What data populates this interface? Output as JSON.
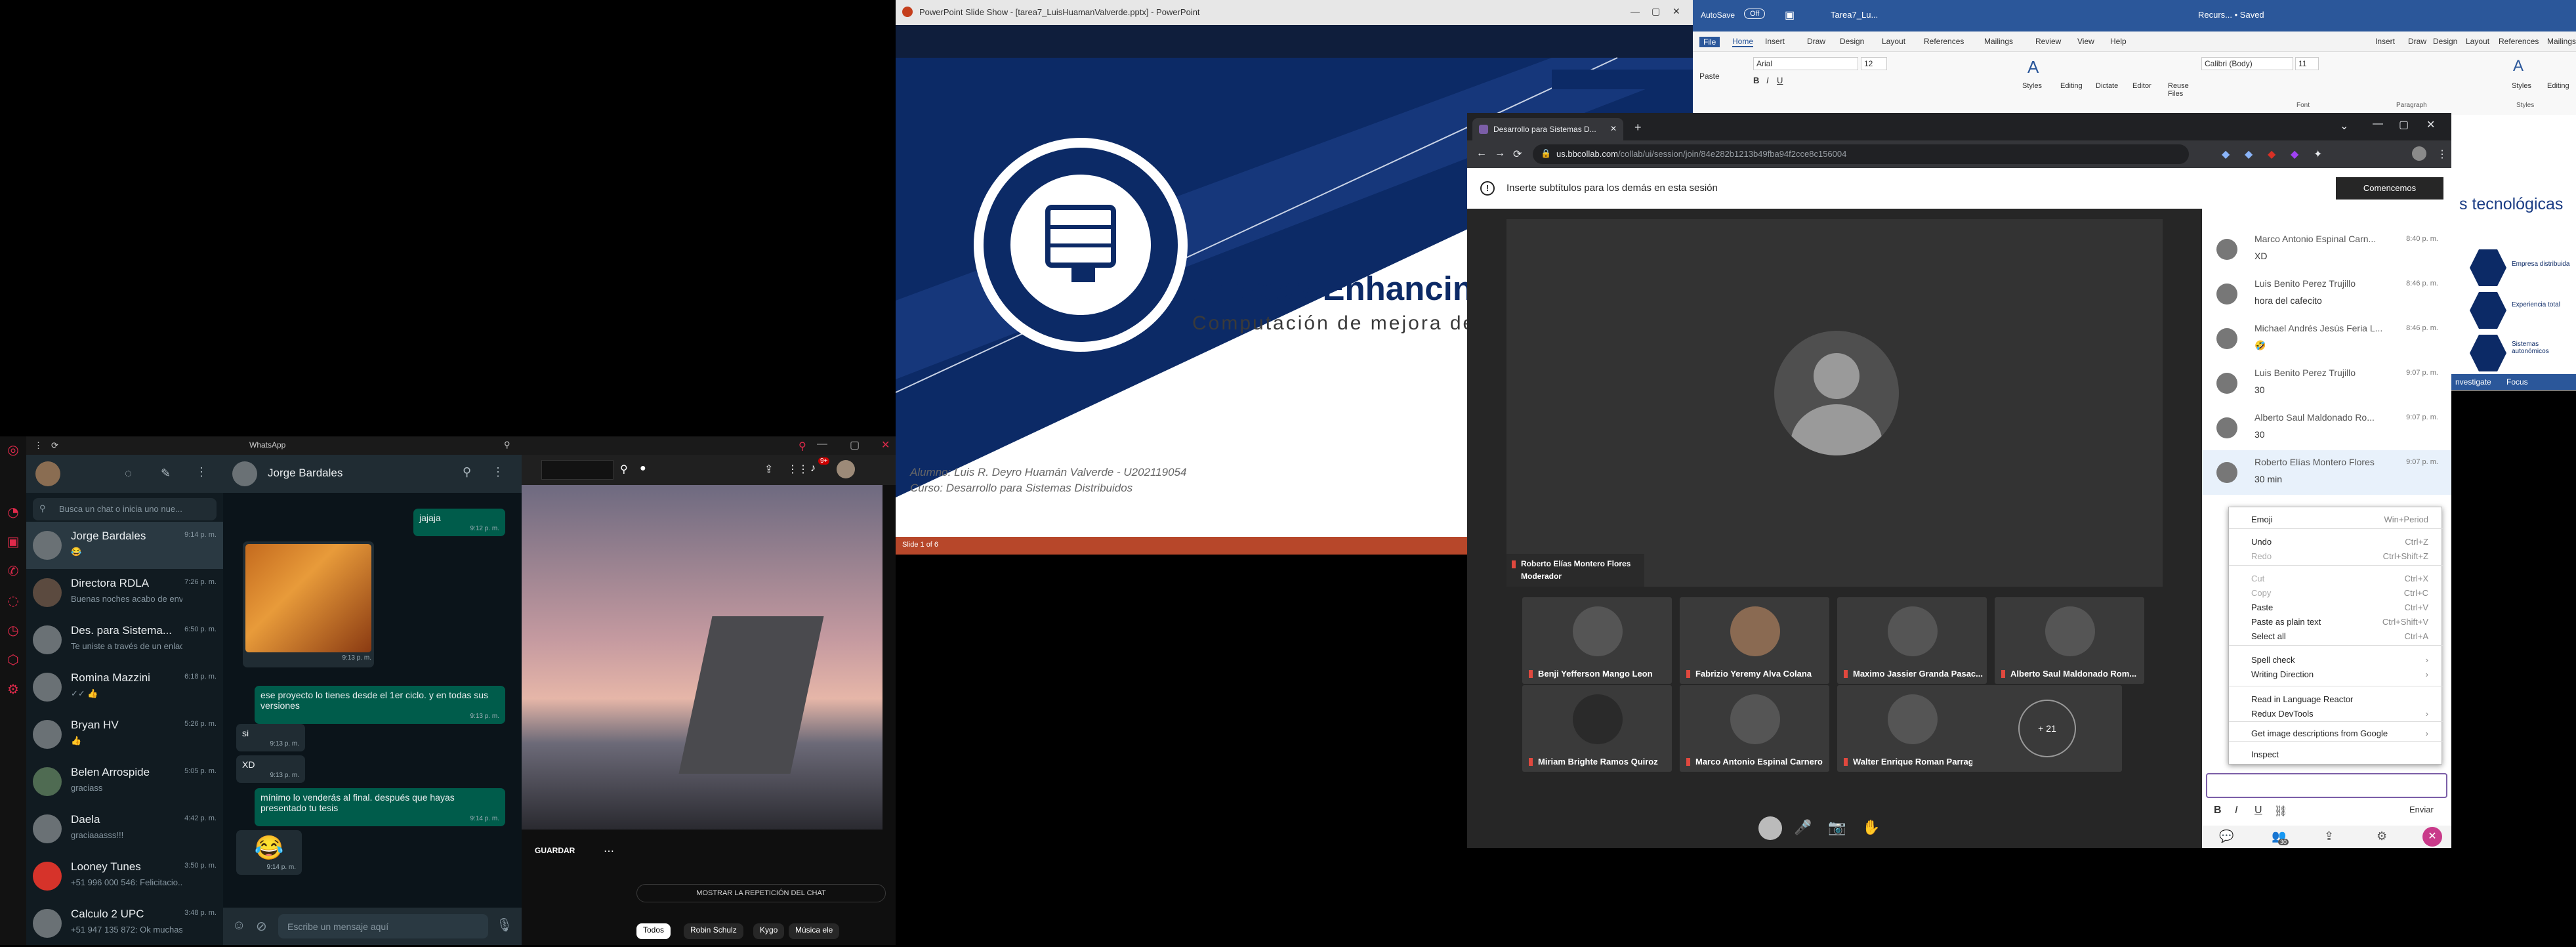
{
  "whatsapp": {
    "window_title": "WhatsApp",
    "search_placeholder": "Busca un chat o inicia uno nue...",
    "contact_name": "Jorge Bardales",
    "compose_placeholder": "Escribe un mensaje aquí",
    "chats": [
      {
        "name": "Jorge Bardales",
        "preview": "😂",
        "time": "9:14 p. m."
      },
      {
        "name": "Directora RDLA",
        "preview": "Buenas noches acabo de envi...",
        "time": "7:26 p. m."
      },
      {
        "name": "Des. para Sistema...",
        "preview": "Te uniste a través de un enlac...",
        "time": "6:50 p. m."
      },
      {
        "name": "Romina Mazzini",
        "preview": "✓✓ 👍",
        "time": "6:18 p. m."
      },
      {
        "name": "Bryan HV",
        "preview": "👍",
        "time": "5:26 p. m."
      },
      {
        "name": "Belen Arrospide",
        "preview": "graciass",
        "time": "5:05 p. m."
      },
      {
        "name": "Daela",
        "preview": "graciaaasss!!!",
        "time": "4:42 p. m."
      },
      {
        "name": "Looney Tunes",
        "preview": "+51 996 000 546: Felicitacio...",
        "time": "3:50 p. m."
      },
      {
        "name": "Calculo 2 UPC",
        "preview": "+51 947 135 872: Ok muchas",
        "time": "3:48 p. m."
      }
    ],
    "messages": [
      {
        "text": "jajaja",
        "time": "9:12 p. m."
      },
      {
        "text": "",
        "time": "9:13 p. m."
      },
      {
        "text": "ese proyecto lo tienes desde el 1er ciclo. y en todas sus versiones",
        "time": "9:13 p. m."
      },
      {
        "text": "si",
        "time": "9:13 p. m."
      },
      {
        "text": "XD",
        "time": "9:13 p. m."
      },
      {
        "text": "mínimo lo venderás al final. después que hayas presentado tu tesis",
        "time": "9:14 p. m."
      },
      {
        "text": "😂",
        "time": "9:14 p. m."
      }
    ]
  },
  "youtube": {
    "save_label": "GUARDAR",
    "chat_replay": "MOSTRAR LA REPETICIÓN DEL CHAT",
    "notif_count": "9+",
    "chips": [
      "Todos",
      "Robin Schulz",
      "Kygo",
      "Música ele"
    ]
  },
  "powerpoint": {
    "title": "PowerPoint Slide Show - [tarea7_LuisHuamanValverde.pptx] - PowerPoint",
    "slide_title": "Privacy-Enhancing",
    "slide_subtitle": "Computación de mejora de",
    "student": "Alumno: Luis R. Deyro Huamán Valverde - U202119054",
    "course": "Curso: Desarrollo para Sistemas Distribuidos",
    "status": "Slide 1 of 6"
  },
  "word": {
    "autosave": "AutoSave",
    "autosave_state": "Off",
    "doc_title": "Tarea7_Lu...",
    "tabs": [
      "File",
      "Home",
      "Insert",
      "Draw",
      "Design",
      "Layout",
      "References",
      "Mailings",
      "Review",
      "View",
      "Help"
    ],
    "font": "Arial",
    "size": "12",
    "groups": [
      "Paste",
      "Styles",
      "Editing",
      "Dictate",
      "Editor",
      "Reuse Files"
    ],
    "right_tabs": [
      "Insert",
      "Draw",
      "Design",
      "Layout",
      "References",
      "Mailings",
      "Review"
    ],
    "right_font": "Calibri (Body)",
    "right_size": "11",
    "right_title": "Recurs... • Saved",
    "right_groups": [
      "Styles",
      "Editing"
    ],
    "sections": [
      "Font",
      "Paragraph",
      "Styles"
    ],
    "side_heading": "s tecnológicas",
    "side_items": [
      "Empresa distribuida",
      "Experiencia total",
      "Sistemas autonómicos"
    ],
    "focus": "Focus",
    "investigate": "nvestigate"
  },
  "collab": {
    "tab_title": "Desarrollo para Sistemas D...",
    "url_host": "us.bbcollab.com",
    "url_path": "/collab/ui/session/join/84e282b1213b49fba94f2cce8c156004",
    "notice": "Inserte subtítulos para los demás en esta sesión",
    "start_btn": "Comencemos",
    "moderator_name": "Roberto Elías Montero Flores",
    "moderator_role": "Moderador",
    "participants": [
      "Benji Yefferson Mango Leon",
      "Fabrizio Yeremy Alva Colana",
      "Maximo Jassier Granda Pasac...",
      "Alberto Saul Maldonado Rom...",
      "Miriam Brighte Ramos Quiroz",
      "Marco Antonio Espinal Carnero",
      "Walter Enrique Roman Parraga"
    ],
    "more_count": "+ 21",
    "chat": [
      {
        "name": "Marco Antonio Espinal Carn...",
        "text": "XD",
        "time": "8:40 p. m."
      },
      {
        "name": "Luis Benito Perez Trujillo",
        "text": "hora del cafecito",
        "time": "8:46 p. m."
      },
      {
        "name": "Michael Andrés Jesús Feria L...",
        "text": "🤣",
        "time": "8:46 p. m."
      },
      {
        "name": "Luis Benito Perez Trujillo",
        "text": "30",
        "time": "9:07 p. m."
      },
      {
        "name": "Alberto Saul Maldonado Ro...",
        "text": "30",
        "time": "9:07 p. m."
      },
      {
        "name": "Roberto Elías Montero Flores",
        "text": "30 min",
        "time": "9:07 p. m."
      }
    ],
    "send_label": "Enviar",
    "badge_count": "30"
  },
  "context_menu": [
    {
      "label": "Emoji",
      "shortcut": "Win+Period"
    },
    {
      "label": "Undo",
      "shortcut": "Ctrl+Z"
    },
    {
      "label": "Redo",
      "shortcut": "Ctrl+Shift+Z"
    },
    {
      "label": "Cut",
      "shortcut": "Ctrl+X"
    },
    {
      "label": "Copy",
      "shortcut": "Ctrl+C"
    },
    {
      "label": "Paste",
      "shortcut": "Ctrl+V"
    },
    {
      "label": "Paste as plain text",
      "shortcut": "Ctrl+Shift+V"
    },
    {
      "label": "Select all",
      "shortcut": "Ctrl+A"
    },
    {
      "label": "Spell check",
      "shortcut": "›"
    },
    {
      "label": "Writing Direction",
      "shortcut": "›"
    },
    {
      "label": "Read in Language Reactor",
      "shortcut": ""
    },
    {
      "label": "Redux DevTools",
      "shortcut": "›"
    },
    {
      "label": "Get image descriptions from Google",
      "shortcut": "›"
    },
    {
      "label": "Inspect",
      "shortcut": ""
    }
  ],
  "colors": {
    "whatsapp_green": "#005c4b",
    "brand_red": "#e02a4b",
    "ppt_navy": "#0c2a66",
    "word_blue": "#2b579a"
  }
}
